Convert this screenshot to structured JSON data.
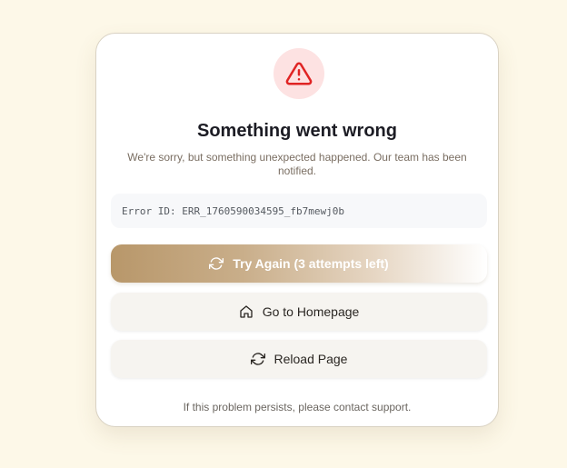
{
  "error_card": {
    "title": "Something went wrong",
    "message": "We're sorry, but something unexpected happened. Our team has been notified.",
    "error_id": "Error ID: ERR_1760590034595_fb7mewj0b",
    "buttons": {
      "try_again": "Try Again (3 attempts left)",
      "home": "Go to Homepage",
      "reload": "Reload Page"
    },
    "footer": "If this problem persists, please contact support."
  },
  "icons": {
    "alert": "alert-triangle-icon",
    "retry": "refresh-icon",
    "home": "home-icon",
    "reload": "reload-icon"
  },
  "colors": {
    "page_background": "#fdf8e8",
    "alert_circle": "#fde2e2",
    "alert_icon": "#e02424",
    "primary_start": "#b8976a"
  }
}
